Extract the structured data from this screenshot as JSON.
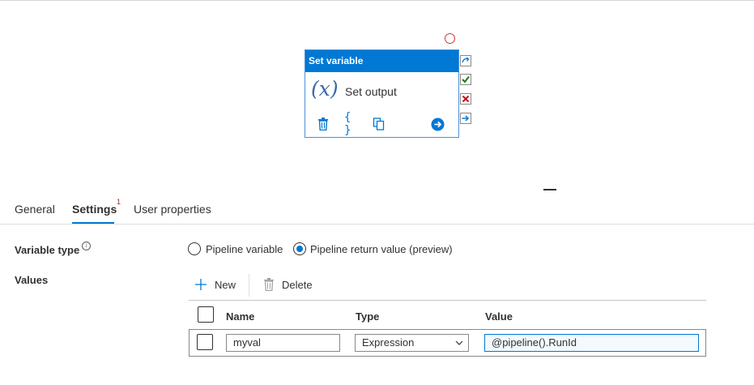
{
  "canvas": {
    "activity": {
      "type_label": "Set variable",
      "icon_text": "(x)",
      "name": "Set output"
    }
  },
  "tabs": {
    "general": "General",
    "settings": "Settings",
    "settings_badge": "1",
    "user_properties": "User properties"
  },
  "settings": {
    "variable_type_label": "Variable type",
    "info_glyph": "i",
    "options": {
      "pipeline_variable": "Pipeline variable",
      "pipeline_return_value": "Pipeline return value (preview)"
    },
    "selected_option": "Pipeline return value (preview)",
    "values_label": "Values",
    "toolbar": {
      "new_label": "New",
      "delete_label": "Delete"
    },
    "grid": {
      "columns": [
        "Name",
        "Type",
        "Value"
      ],
      "rows": [
        {
          "name": "myval",
          "type": "Expression",
          "value": "@pipeline().RunId"
        }
      ]
    }
  },
  "colors": {
    "accent": "#0078d4",
    "error": "#d13438",
    "success": "#107c10"
  }
}
